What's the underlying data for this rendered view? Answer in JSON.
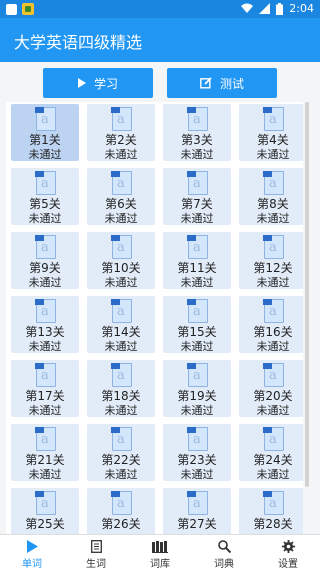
{
  "status_bar": {
    "time": "2:04"
  },
  "app_bar": {
    "title": "大学英语四级精选"
  },
  "actions": {
    "study_label": "学习",
    "test_label": "测试"
  },
  "levels": [
    {
      "label": "第1关",
      "status": "未通过",
      "selected": true
    },
    {
      "label": "第2关",
      "status": "未通过"
    },
    {
      "label": "第3关",
      "status": "未通过"
    },
    {
      "label": "第4关",
      "status": "未通过"
    },
    {
      "label": "第5关",
      "status": "未通过"
    },
    {
      "label": "第6关",
      "status": "未通过"
    },
    {
      "label": "第7关",
      "status": "未通过"
    },
    {
      "label": "第8关",
      "status": "未通过"
    },
    {
      "label": "第9关",
      "status": "未通过"
    },
    {
      "label": "第10关",
      "status": "未通过"
    },
    {
      "label": "第11关",
      "status": "未通过"
    },
    {
      "label": "第12关",
      "status": "未通过"
    },
    {
      "label": "第13关",
      "status": "未通过"
    },
    {
      "label": "第14关",
      "status": "未通过"
    },
    {
      "label": "第15关",
      "status": "未通过"
    },
    {
      "label": "第16关",
      "status": "未通过"
    },
    {
      "label": "第17关",
      "status": "未通过"
    },
    {
      "label": "第18关",
      "status": "未通过"
    },
    {
      "label": "第19关",
      "status": "未通过"
    },
    {
      "label": "第20关",
      "status": "未通过"
    },
    {
      "label": "第21关",
      "status": "未通过"
    },
    {
      "label": "第22关",
      "status": "未通过"
    },
    {
      "label": "第23关",
      "status": "未通过"
    },
    {
      "label": "第24关",
      "status": "未通过"
    },
    {
      "label": "第25关",
      "status": ""
    },
    {
      "label": "第26关",
      "status": ""
    },
    {
      "label": "第27关",
      "status": ""
    },
    {
      "label": "第28关",
      "status": ""
    }
  ],
  "doc_icon_letter": "a",
  "bottom_nav": [
    {
      "label": "单词",
      "icon": "play-icon",
      "active": true
    },
    {
      "label": "生词",
      "icon": "note-icon"
    },
    {
      "label": "词库",
      "icon": "books-icon"
    },
    {
      "label": "词典",
      "icon": "search-icon"
    },
    {
      "label": "设置",
      "icon": "gear-icon"
    }
  ],
  "colors": {
    "primary": "#2196f3",
    "status_bar": "#1a86e0",
    "cell": "#e2ecf8",
    "cell_selected": "#bcd4f2"
  }
}
